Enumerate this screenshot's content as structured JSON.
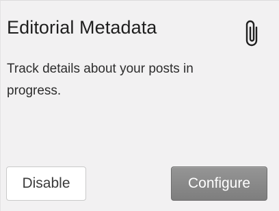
{
  "module": {
    "title": "Editorial Metadata",
    "description": "Track details about your posts in progress.",
    "icon": "paperclip-icon",
    "buttons": {
      "disable_label": "Disable",
      "configure_label": "Configure"
    }
  },
  "colors": {
    "card_background": "#f2f1f2",
    "title_text": "#1e1e1e",
    "configure_button": "#888888",
    "disable_button": "#ffffff"
  }
}
